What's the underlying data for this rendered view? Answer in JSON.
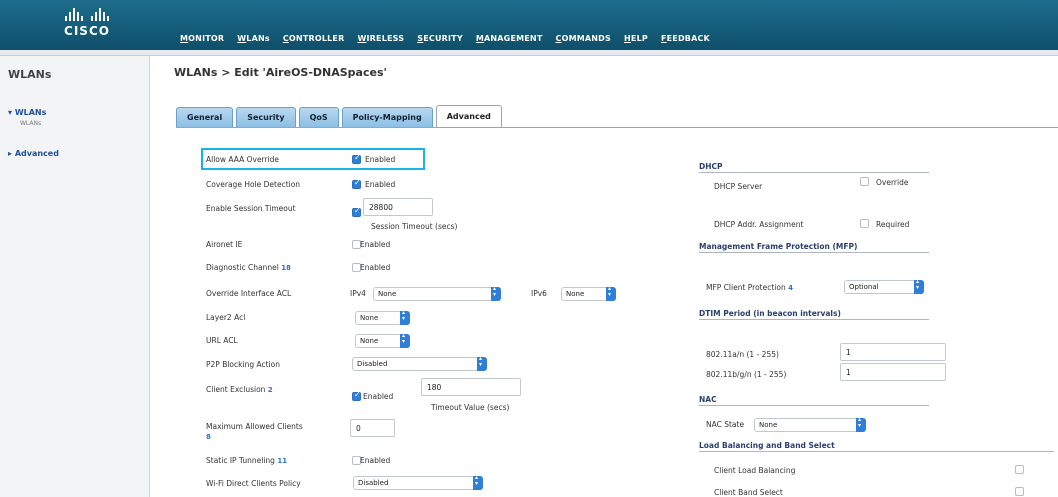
{
  "header": {
    "logo_text": "CISCO",
    "nav": [
      "MONITOR",
      "WLANs",
      "CONTROLLER",
      "WIRELESS",
      "SECURITY",
      "MANAGEMENT",
      "COMMANDS",
      "HELP",
      "FEEDBACK"
    ]
  },
  "sidebar": {
    "title": "WLANs",
    "items": [
      {
        "label": "WLANs",
        "sub": "WLANs"
      },
      {
        "label": "Advanced"
      }
    ]
  },
  "breadcrumb": "WLANs > Edit  'AireOS-DNASpaces'",
  "tabs": [
    "General",
    "Security",
    "QoS",
    "Policy-Mapping",
    "Advanced"
  ],
  "left": {
    "aaa_override": {
      "label": "Allow AAA Override",
      "value": "Enabled"
    },
    "coverage_hole": {
      "label": "Coverage Hole Detection",
      "value": "Enabled"
    },
    "session_timeout": {
      "label": "Enable Session Timeout",
      "value": "28800",
      "hint": "Session Timeout (secs)"
    },
    "aironet_ie": {
      "label": "Aironet IE",
      "value": "Enabled"
    },
    "diag_channel": {
      "label": "Diagnostic Channel",
      "sup": "18",
      "value": "Enabled"
    },
    "override_acl": {
      "label": "Override Interface ACL",
      "ipv4_label": "IPv4",
      "ipv4_value": "None",
      "ipv6_label": "IPv6",
      "ipv6_value": "None"
    },
    "layer2_acl": {
      "label": "Layer2 Acl",
      "value": "None"
    },
    "url_acl": {
      "label": "URL ACL",
      "value": "None"
    },
    "p2p": {
      "label": "P2P Blocking Action",
      "value": "Disabled"
    },
    "client_exclusion": {
      "label": "Client Exclusion",
      "sup": "2",
      "check_label": "Enabled",
      "value": "180",
      "hint": "Timeout Value (secs)"
    },
    "max_clients": {
      "label": "Maximum Allowed Clients",
      "sup": "8",
      "value": "0"
    },
    "static_ip": {
      "label": "Static IP Tunneling",
      "sup": "11",
      "value": "Enabled"
    },
    "wifi_direct": {
      "label": "Wi-Fi Direct Clients Policy",
      "value": "Disabled"
    }
  },
  "right": {
    "dhcp": {
      "title": "DHCP",
      "server_label": "DHCP Server",
      "server_value": "Override",
      "assign_label": "DHCP Addr. Assignment",
      "assign_value": "Required"
    },
    "mfp": {
      "title": "Management Frame Protection (MFP)",
      "label": "MFP Client Protection",
      "sup": "4",
      "value": "Optional"
    },
    "dtim": {
      "title": "DTIM Period (in beacon intervals)",
      "a_label": "802.11a/n (1 - 255)",
      "a_value": "1",
      "b_label": "802.11b/g/n (1 - 255)",
      "b_value": "1"
    },
    "nac": {
      "title": "NAC",
      "label": "NAC State",
      "value": "None"
    },
    "lb": {
      "title": "Load Balancing and Band Select",
      "balancing": "Client Load Balancing",
      "band": "Client Band Select"
    }
  }
}
